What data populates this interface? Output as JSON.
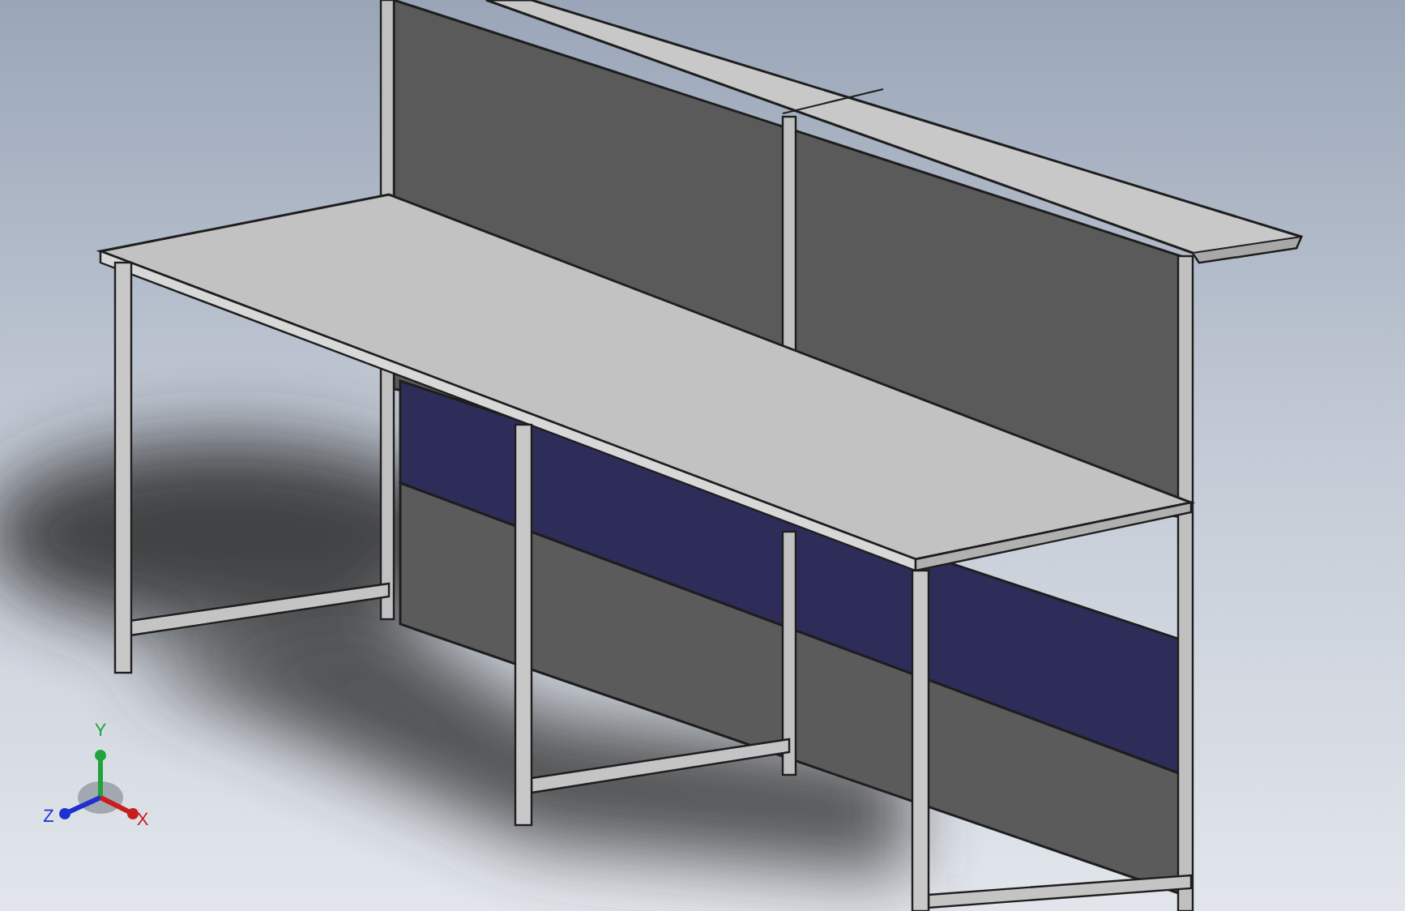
{
  "viewport": {
    "triad": {
      "axes": [
        {
          "label": "Y",
          "color": "#1fa33a"
        },
        {
          "label": "Z",
          "color": "#1f2fd0"
        },
        {
          "label": "X",
          "color": "#c81e1e"
        }
      ]
    }
  }
}
